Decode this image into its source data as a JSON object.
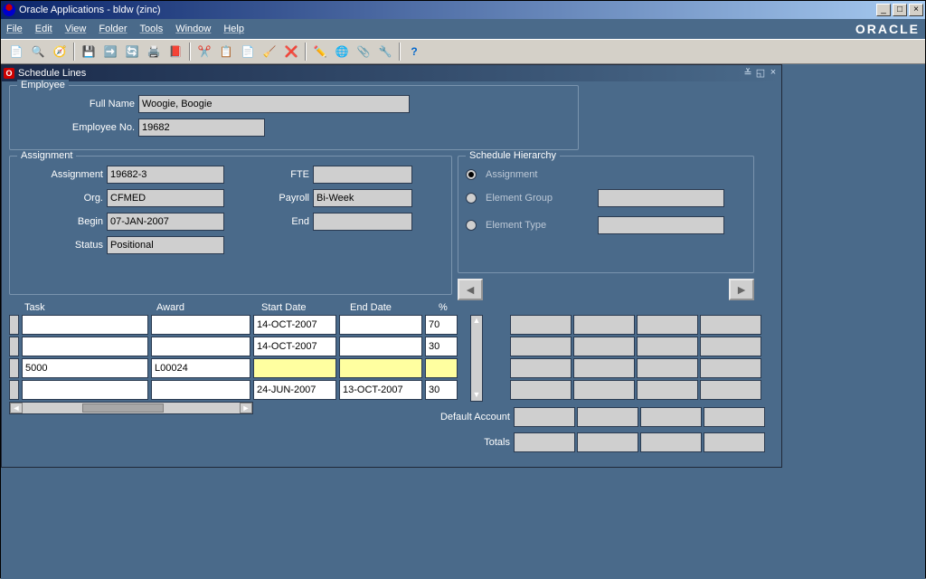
{
  "window": {
    "title": "Oracle Applications - bldw (zinc)"
  },
  "brand": "ORACLE",
  "menus": [
    "File",
    "Edit",
    "View",
    "Folder",
    "Tools",
    "Window",
    "Help"
  ],
  "inner": {
    "title": "Schedule Lines"
  },
  "employee": {
    "legend": "Employee",
    "full_name_label": "Full Name",
    "full_name": "Woogie, Boogie",
    "emp_no_label": "Employee No.",
    "emp_no": "19682"
  },
  "assignment": {
    "legend": "Assignment",
    "assignment_label": "Assignment",
    "assignment": "19682-3",
    "fte_label": "FTE",
    "fte": "",
    "org_label": "Org.",
    "org": "CFMED",
    "payroll_label": "Payroll",
    "payroll": "Bi-Week",
    "begin_label": "Begin",
    "begin": "07-JAN-2007",
    "end_label": "End",
    "end": "",
    "status_label": "Status",
    "status": "Positional"
  },
  "hierarchy": {
    "legend": "Schedule Hierarchy",
    "assignment_label": "Assignment",
    "element_group_label": "Element Group",
    "element_type_label": "Element Type",
    "selected": "assignment"
  },
  "table": {
    "headers": {
      "task": "Task",
      "award": "Award",
      "start": "Start Date",
      "end": "End Date",
      "pct": "%"
    },
    "rows": [
      {
        "task": "",
        "award": "",
        "start": "14-OCT-2007",
        "end": "",
        "pct": "70",
        "hl": false
      },
      {
        "task": "",
        "award": "",
        "start": "14-OCT-2007",
        "end": "",
        "pct": "30",
        "hl": false
      },
      {
        "task": "5000",
        "award": "L00024",
        "start": "",
        "end": "",
        "pct": "",
        "hl": true
      },
      {
        "task": "",
        "award": "",
        "start": "24-JUN-2007",
        "end": "13-OCT-2007",
        "pct": "30",
        "hl": false
      }
    ]
  },
  "footer": {
    "default_account_label": "Default Account",
    "totals_label": "Totals"
  }
}
